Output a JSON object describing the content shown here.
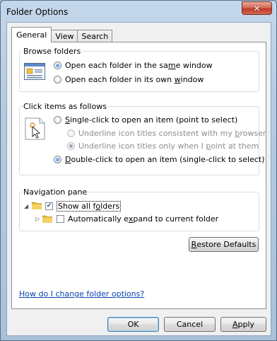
{
  "window": {
    "title": "Folder Options",
    "close_glyph": "✕"
  },
  "tabs": [
    {
      "label": "General",
      "active": true
    },
    {
      "label": "View",
      "active": false
    },
    {
      "label": "Search",
      "active": false
    }
  ],
  "browse_folders": {
    "legend": "Browse folders",
    "options": [
      {
        "pre": "Open each folder in the sa",
        "key": "m",
        "post": "e window",
        "checked": true
      },
      {
        "pre": "Open each folder in its own ",
        "key": "w",
        "post": "indow",
        "checked": false
      }
    ]
  },
  "click_items": {
    "legend": "Click items as follows",
    "single": {
      "pre": "",
      "key": "S",
      "post": "ingle-click to open an item (point to select)",
      "checked": false
    },
    "sub_a": {
      "pre": "Underline icon titles consistent with my ",
      "key": "b",
      "post": "rowser",
      "checked": false
    },
    "sub_b": {
      "pre": "Underline icon titles only when I ",
      "key": "p",
      "post": "oint at them",
      "checked": true
    },
    "double": {
      "pre": "",
      "key": "D",
      "post": "ouble-click to open an item (single-click to select)",
      "checked": true
    }
  },
  "navigation_pane": {
    "legend": "Navigation pane",
    "show_all": {
      "pre": "Show all f",
      "key": "o",
      "post": "lders",
      "checked": true
    },
    "auto_expand": {
      "pre": "Automatically e",
      "key": "x",
      "post": "pand to current folder",
      "checked": false
    }
  },
  "restore_defaults": {
    "pre": "",
    "key": "R",
    "post": "estore Defaults"
  },
  "help_link": "How do I change folder options?",
  "buttons": {
    "ok": "OK",
    "cancel": "Cancel",
    "apply": {
      "pre": "",
      "key": "A",
      "post": "pply"
    }
  },
  "colors": {
    "accent": "#1d5fbf",
    "link": "#0645ad",
    "folder": "#e8b93a"
  }
}
